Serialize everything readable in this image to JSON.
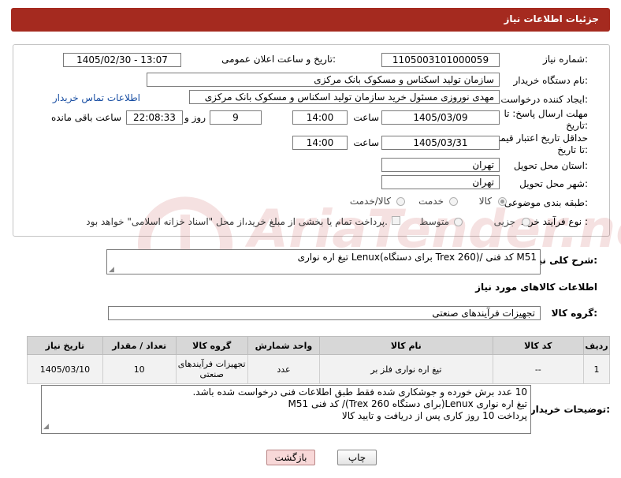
{
  "header": {
    "title": "جزئیات اطلاعات نیاز"
  },
  "labels": {
    "need_number": "شماره نیاز:",
    "announce_date": "تاریخ و ساعت اعلان عمومی:",
    "buyer_org": "نام دستگاه خریدار:",
    "requester": "ایجاد کننده درخواست:",
    "reply_deadline": "مهلت ارسال پاسخ: تا تاریخ:",
    "price_validity": "حداقل تاریخ اعتبار قیمت: تا تاریخ:",
    "time": "ساعت",
    "day_and": "روز و",
    "remaining": "ساعت باقی مانده",
    "province": "استان محل تحویل:",
    "city": "شهر محل تحویل:",
    "category": "طبقه بندی موضوعی:",
    "process_type": "نوع فرآیند خرید :",
    "general_desc": "شرح کلی نیاز:",
    "goods_info": "اطلاعات کالاهای مورد نیاز",
    "goods_group": "گروه کالا:",
    "buyer_notes": "توضیحات خریدار:"
  },
  "fields": {
    "need_number": "1105003101000059",
    "announce_datetime": "1405/02/30 - 13:07",
    "buyer_org": "سازمان تولید اسکناس و مسکوک بانک مرکزی",
    "requester": "مهدی نوروزی مسئول خرید سازمان تولید اسکناس و مسکوک بانک مرکزی",
    "contact_link": "اطلاعات تماس خریدار",
    "reply_date": "1405/03/09",
    "reply_time": "14:00",
    "reply_days": "9",
    "reply_remaining": "22:08:33",
    "validity_date": "1405/03/31",
    "validity_time": "14:00",
    "province": "تهران",
    "city": "تهران",
    "general_desc": "تیغ اره نواری Lenux(برای دستگاه Trex 260)/ کد فنی M51",
    "goods_group": "تجهیزات فرآیندهای صنعتی"
  },
  "category_options": [
    {
      "label": "کالا",
      "selected": true
    },
    {
      "label": "خدمت",
      "selected": false
    },
    {
      "label": "کالا/خدمت",
      "selected": false
    }
  ],
  "process_options": [
    {
      "label": "جزیی",
      "selected": false
    },
    {
      "label": "متوسط",
      "selected": false
    }
  ],
  "payment_note": "پرداخت تمام یا بخشی از مبلغ خرید،از محل \"اسناد خزانه اسلامی\" خواهد بود.",
  "table": {
    "headers": [
      "ردیف",
      "کد کالا",
      "نام کالا",
      "واحد شمارش",
      "گروه کالا",
      "تعداد / مقدار",
      "تاریخ نیاز"
    ],
    "rows": [
      [
        "1",
        "--",
        "تیغ اره نواری فلز بر",
        "عدد",
        "تجهیزات فرآیندهای صنعتی",
        "10",
        "1405/03/10"
      ]
    ]
  },
  "buyer_notes": [
    "10 عدد برش خورده و جوشکاری شده فقط طبق اطلاعات فنی درخواست شده باشد.",
    "تیغ اره نواری Lenux(برای دستگاه Trex 260)/ کد فنی M51",
    "پرداخت 10 روز کاری پس از دریافت و تایید کالا"
  ],
  "buttons": {
    "print": "چاپ",
    "back": "بازگشت"
  },
  "watermark": {
    "text": "AriaTender.net"
  },
  "colors": {
    "header_bg": "#a52a1f",
    "link": "#1a4fa3",
    "back_bg": "#f8d8d8"
  }
}
